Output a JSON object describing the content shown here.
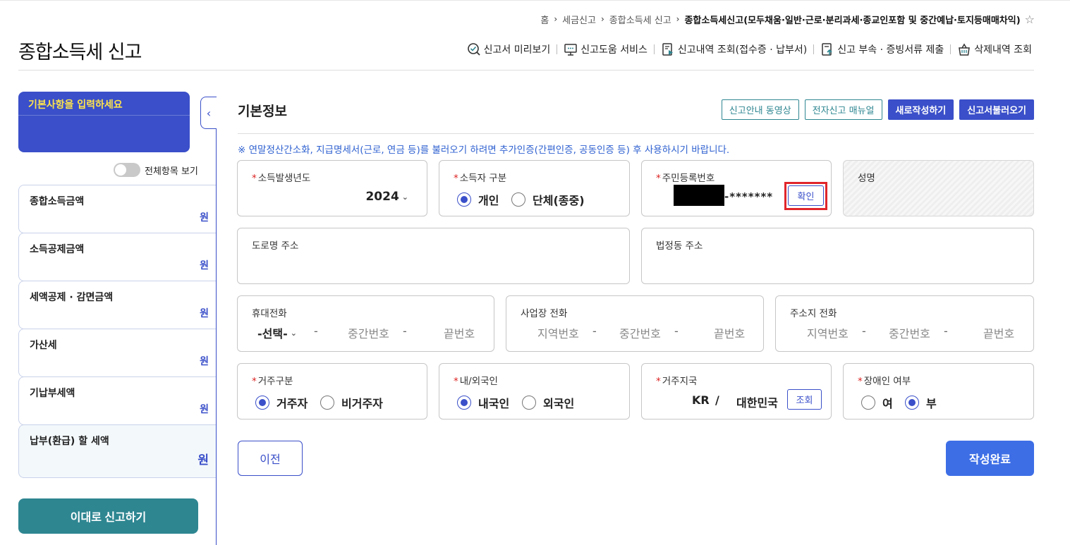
{
  "breadcrumb": [
    "홈",
    "세금신고",
    "종합소득세 신고"
  ],
  "breadcrumb_current": "종합소득세신고(모두채움·일반·근로·분리과세·종교인포함 및 중간예납·토지등매매차익)",
  "page_title": "종합소득세 신고",
  "top_menu": [
    {
      "label": "신고서 미리보기",
      "icon": "magnifier-check-icon"
    },
    {
      "label": "신고도움 서비스",
      "icon": "monitor-help-icon"
    },
    {
      "label": "신고내역 조회(접수증 · 납부서)",
      "icon": "document-play-icon"
    },
    {
      "label": "신고 부속 · 증빙서류 제출",
      "icon": "document-upload-icon"
    },
    {
      "label": "삭제내역 조회",
      "icon": "basket-icon"
    }
  ],
  "sidebar": {
    "step_label": "기본사항을 입력하세요",
    "toggle_label": "전체항목 보기",
    "items": [
      {
        "label": "종합소득금액",
        "unit": "원"
      },
      {
        "label": "소득공제금액",
        "unit": "원"
      },
      {
        "label": "세액공제 · 감면금액",
        "unit": "원"
      },
      {
        "label": "가산세",
        "unit": "원"
      },
      {
        "label": "기납부세액",
        "unit": "원"
      },
      {
        "label": "납부(환급) 할 세액",
        "unit": "원"
      }
    ],
    "submit_label": "이대로 신고하기"
  },
  "main": {
    "section_title": "기본정보",
    "buttons": [
      "신고안내 동영상",
      "전자신고 매뉴얼",
      "새로작성하기",
      "신고서불러오기"
    ],
    "notice": "※ 연말정산간소화, 지급명세서(근로, 연금 등)를 불러오기 하려면 추가인증(간편인증, 공동인증 등) 후 사용하시기 바랍니다.",
    "income_year": {
      "label": "소득발생년도",
      "value": "2024"
    },
    "income_type": {
      "label": "소득자 구분",
      "options": [
        "개인",
        "단체(종중)"
      ],
      "selected": "개인"
    },
    "rrn": {
      "label": "주민등록번호",
      "masked": "-*******",
      "confirm": "확인"
    },
    "name": {
      "label": "성명"
    },
    "road_address": {
      "label": "도로명 주소"
    },
    "lot_address": {
      "label": "법정동 주소"
    },
    "mobile": {
      "label": "휴대전화",
      "select": "-선택-",
      "middle": "중간번호",
      "last": "끝번호",
      "dash": "-"
    },
    "work_phone": {
      "label": "사업장 전화",
      "area": "지역번호",
      "middle": "중간번호",
      "last": "끝번호",
      "dash": "-"
    },
    "home_phone": {
      "label": "주소지 전화",
      "area": "지역번호",
      "middle": "중간번호",
      "last": "끝번호",
      "dash": "-"
    },
    "residency": {
      "label": "거주구분",
      "options": [
        "거주자",
        "비거주자"
      ],
      "selected": "거주자"
    },
    "nationality": {
      "label": "내/외국인",
      "options": [
        "내국인",
        "외국인"
      ],
      "selected": "내국인"
    },
    "country": {
      "label": "거주지국",
      "code": "KR",
      "slash": "/",
      "name": "대한민국",
      "lookup": "조회"
    },
    "disabled": {
      "label": "장애인 여부",
      "options": [
        "여",
        "부"
      ],
      "selected": "부"
    },
    "prev_label": "이전",
    "done_label": "작성완료"
  },
  "colors": {
    "primary": "#3a4fc9",
    "teal": "#2e8691",
    "notice": "#2f61d0",
    "highlight": "#e0262b"
  }
}
